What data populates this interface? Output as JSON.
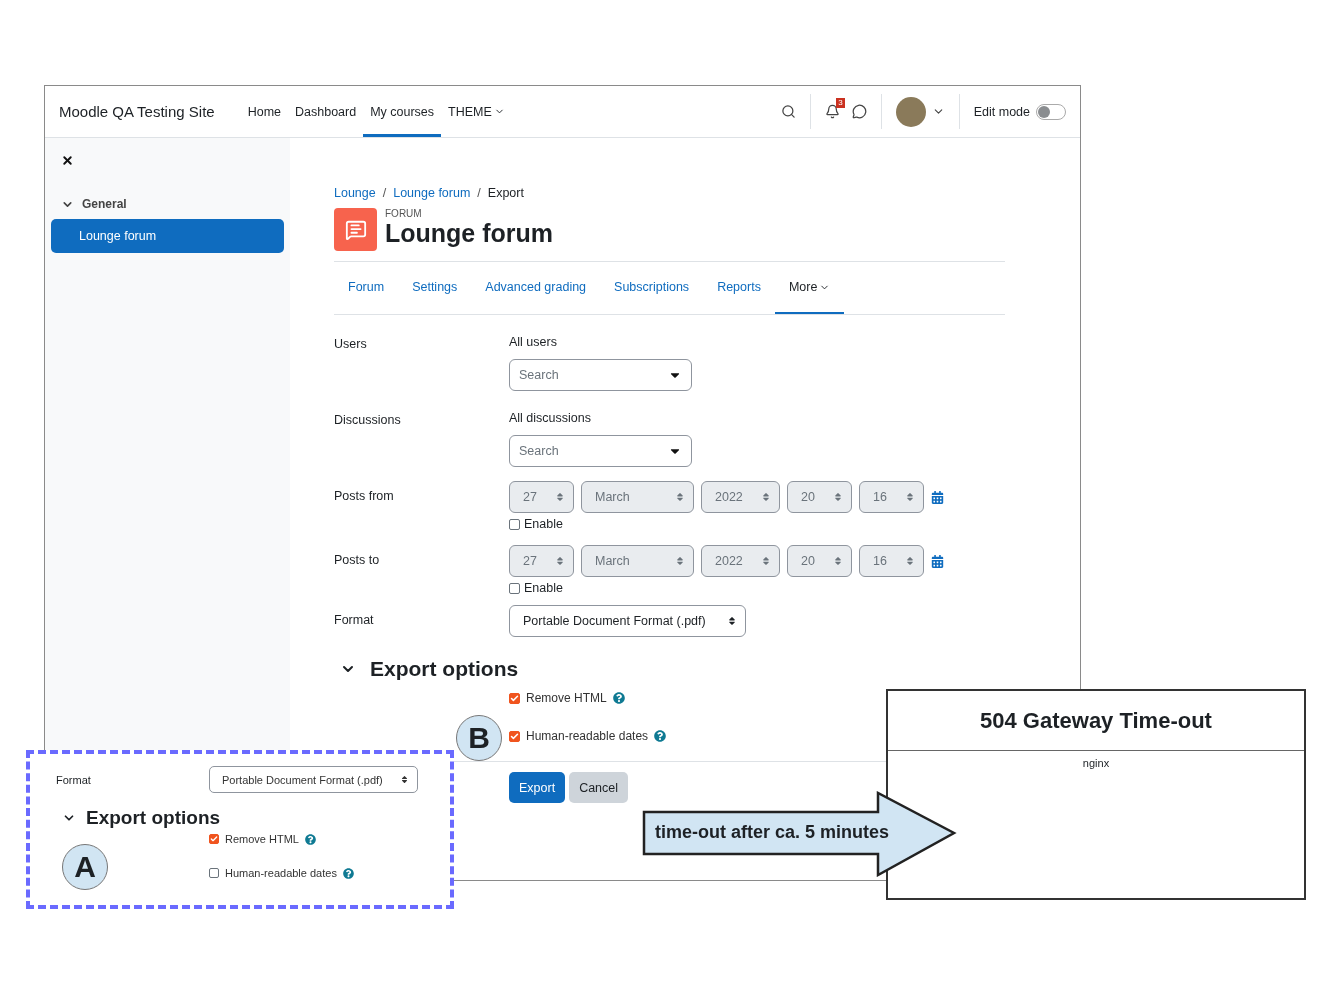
{
  "navbar": {
    "site_name": "Moodle QA Testing Site",
    "links": [
      {
        "label": "Home",
        "selected": false
      },
      {
        "label": "Dashboard",
        "selected": false
      },
      {
        "label": "My courses",
        "selected": true
      },
      {
        "label": "THEME",
        "selected": false
      }
    ],
    "notification_count": "3",
    "edit_mode": {
      "label": "Edit mode",
      "on": false
    }
  },
  "sidebar": {
    "section": "General",
    "expanded": true,
    "items": [
      {
        "label": "Lounge forum",
        "selected": true
      }
    ]
  },
  "breadcrumb_separator": "/",
  "breadcrumb": [
    {
      "label": "Lounge",
      "link": true
    },
    {
      "label": "Lounge forum",
      "link": true
    },
    {
      "label": "Export",
      "link": false
    }
  ],
  "activity_type": "FORUM",
  "page_title": "Lounge forum",
  "tabs": [
    {
      "label": "Forum",
      "selected": false
    },
    {
      "label": "Settings",
      "selected": false
    },
    {
      "label": "Advanced grading",
      "selected": false
    },
    {
      "label": "Subscriptions",
      "selected": false
    },
    {
      "label": "Reports",
      "selected": false
    },
    {
      "label": "More",
      "selected": true
    }
  ],
  "users": {
    "label": "Users",
    "value": "All users",
    "placeholder": "Search"
  },
  "discussions": {
    "label": "Discussions",
    "value": "All discussions",
    "placeholder": "Search"
  },
  "dates": [
    {
      "label": "Posts from",
      "day": "27",
      "month": "March",
      "year": "2022",
      "hour": "20",
      "minute": "16",
      "enable": {
        "label": "Enable",
        "checked": false
      }
    },
    {
      "label": "Posts to",
      "day": "27",
      "month": "March",
      "year": "2022",
      "hour": "20",
      "minute": "16",
      "enable": {
        "label": "Enable",
        "checked": false
      }
    }
  ],
  "format": {
    "label": "Format",
    "value": "Portable Document Format (.pdf)"
  },
  "export_options": {
    "title": "Export options",
    "expanded": true,
    "options": [
      {
        "label": "Remove HTML",
        "checked": true
      },
      {
        "label": "Human-readable dates",
        "checked": true
      }
    ]
  },
  "buttons": [
    {
      "label": "Export",
      "kind": "primary"
    },
    {
      "label": "Cancel",
      "kind": "secondary"
    }
  ],
  "callout_a": {
    "marker": "A",
    "format_label": "Format",
    "format_value": "Portable Document Format (.pdf)",
    "export_title": "Export options",
    "options": [
      {
        "label": "Remove HTML",
        "checked": true
      },
      {
        "label": "Human-readable dates",
        "checked": false
      }
    ]
  },
  "marker_b": "B",
  "arrow_note": "time-out after ca. 5 minutes",
  "error_page": {
    "title": "504 Gateway Time-out",
    "server": "nginx"
  }
}
